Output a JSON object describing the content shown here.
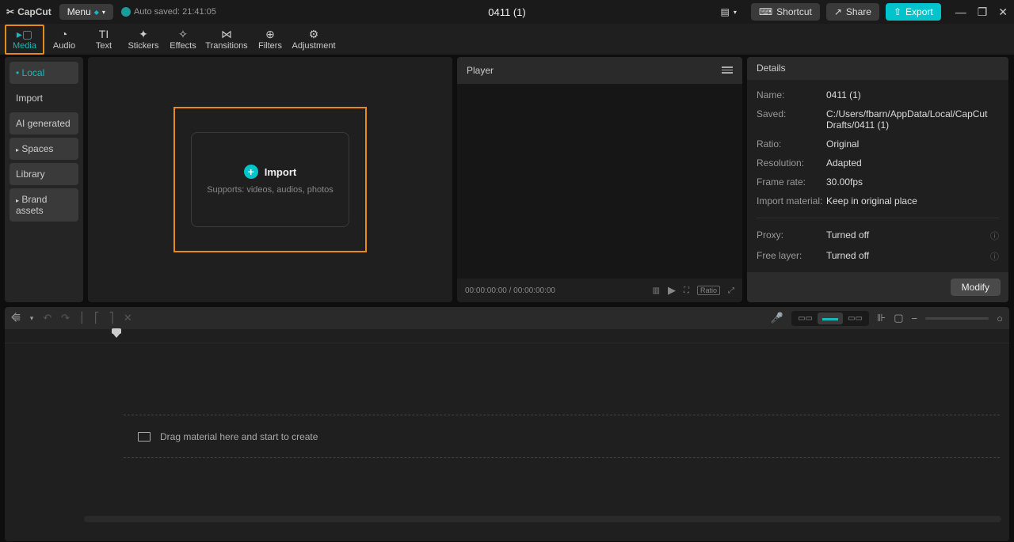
{
  "titlebar": {
    "app_name": "CapCut",
    "menu_label": "Menu",
    "autosave_label": "Auto saved: 21:41:05",
    "project_title": "0411 (1)",
    "shortcut_label": "Shortcut",
    "share_label": "Share",
    "export_label": "Export"
  },
  "tabs": {
    "media": "Media",
    "audio": "Audio",
    "text": "Text",
    "stickers": "Stickers",
    "effects": "Effects",
    "transitions": "Transitions",
    "filters": "Filters",
    "adjustment": "Adjustment"
  },
  "sidebar": {
    "local": "Local",
    "import": "Import",
    "ai": "AI generated",
    "spaces": "Spaces",
    "library": "Library",
    "brand": "Brand assets"
  },
  "import_box": {
    "title": "Import",
    "subtitle": "Supports: videos, audios, photos"
  },
  "player": {
    "title": "Player",
    "time": "00:00:00:00 / 00:00:00:00",
    "ratio_badge": "Ratio"
  },
  "details": {
    "title": "Details",
    "name_label": "Name:",
    "name_value": "0411 (1)",
    "saved_label": "Saved:",
    "saved_value": "C:/Users/fbarn/AppData/Local/CapCut Drafts/0411 (1)",
    "ratio_label": "Ratio:",
    "ratio_value": "Original",
    "resolution_label": "Resolution:",
    "resolution_value": "Adapted",
    "framerate_label": "Frame rate:",
    "framerate_value": "30.00fps",
    "import_material_label": "Import material:",
    "import_material_value": "Keep in original place",
    "proxy_label": "Proxy:",
    "proxy_value": "Turned off",
    "freelayer_label": "Free layer:",
    "freelayer_value": "Turned off",
    "modify_label": "Modify"
  },
  "timeline": {
    "drop_hint": "Drag material here and start to create"
  }
}
